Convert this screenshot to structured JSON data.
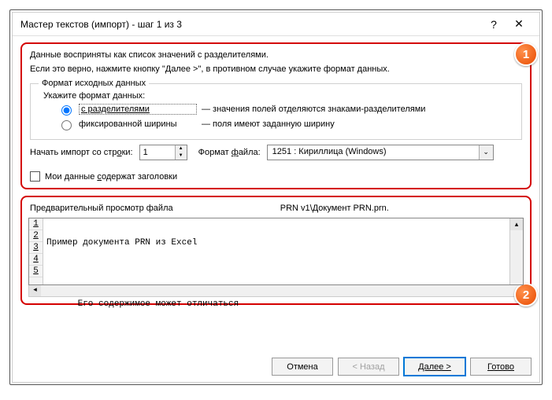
{
  "titlebar": {
    "title": "Мастер текстов (импорт) - шаг 1 из 3",
    "help": "?",
    "close": "✕"
  },
  "top": {
    "line1": "Данные восприняты как список значений с разделителями.",
    "line2": "Если это верно, нажмите кнопку \"Далее >\", в противном случае укажите формат данных.",
    "group_legend": "Формат исходных данных",
    "format_prompt": "Укажите формат данных:",
    "radio1_label": "с разделителями",
    "radio1_explain": "— значения полей отделяются знаками-разделителями",
    "radio2_label": "фиксированной ширины",
    "radio2_explain": "— поля имеют заданную ширину",
    "start_label_pre": "Начать импорт со стр",
    "start_label_u": "о",
    "start_label_post": "ки:",
    "start_value": "1",
    "file_format_label_pre": "Формат ",
    "file_format_label_u": "ф",
    "file_format_label_post": "айла:",
    "file_format_value": "1251 : Кириллица (Windows)",
    "headers_label_pre": "Мои данные ",
    "headers_label_u": "с",
    "headers_label_post": "одержат заголовки"
  },
  "preview": {
    "title_pre": "Предварительный просмотр файла",
    "title_path": "PRN v1\\Документ PRN.prn.",
    "lines": {
      "l1": "Пример документа PRN из Excel",
      "l2": "",
      "l3": "      Его содержимое может отличаться",
      "l4": "",
      "l5": ""
    },
    "gutter": {
      "g1": "1",
      "g2": "2",
      "g3": "3",
      "g4": "4",
      "g5": "5"
    }
  },
  "buttons": {
    "cancel": "Отмена",
    "back": "< Назад",
    "next": "Далее >",
    "finish": "Готово"
  },
  "badges": {
    "b1": "1",
    "b2": "2"
  }
}
